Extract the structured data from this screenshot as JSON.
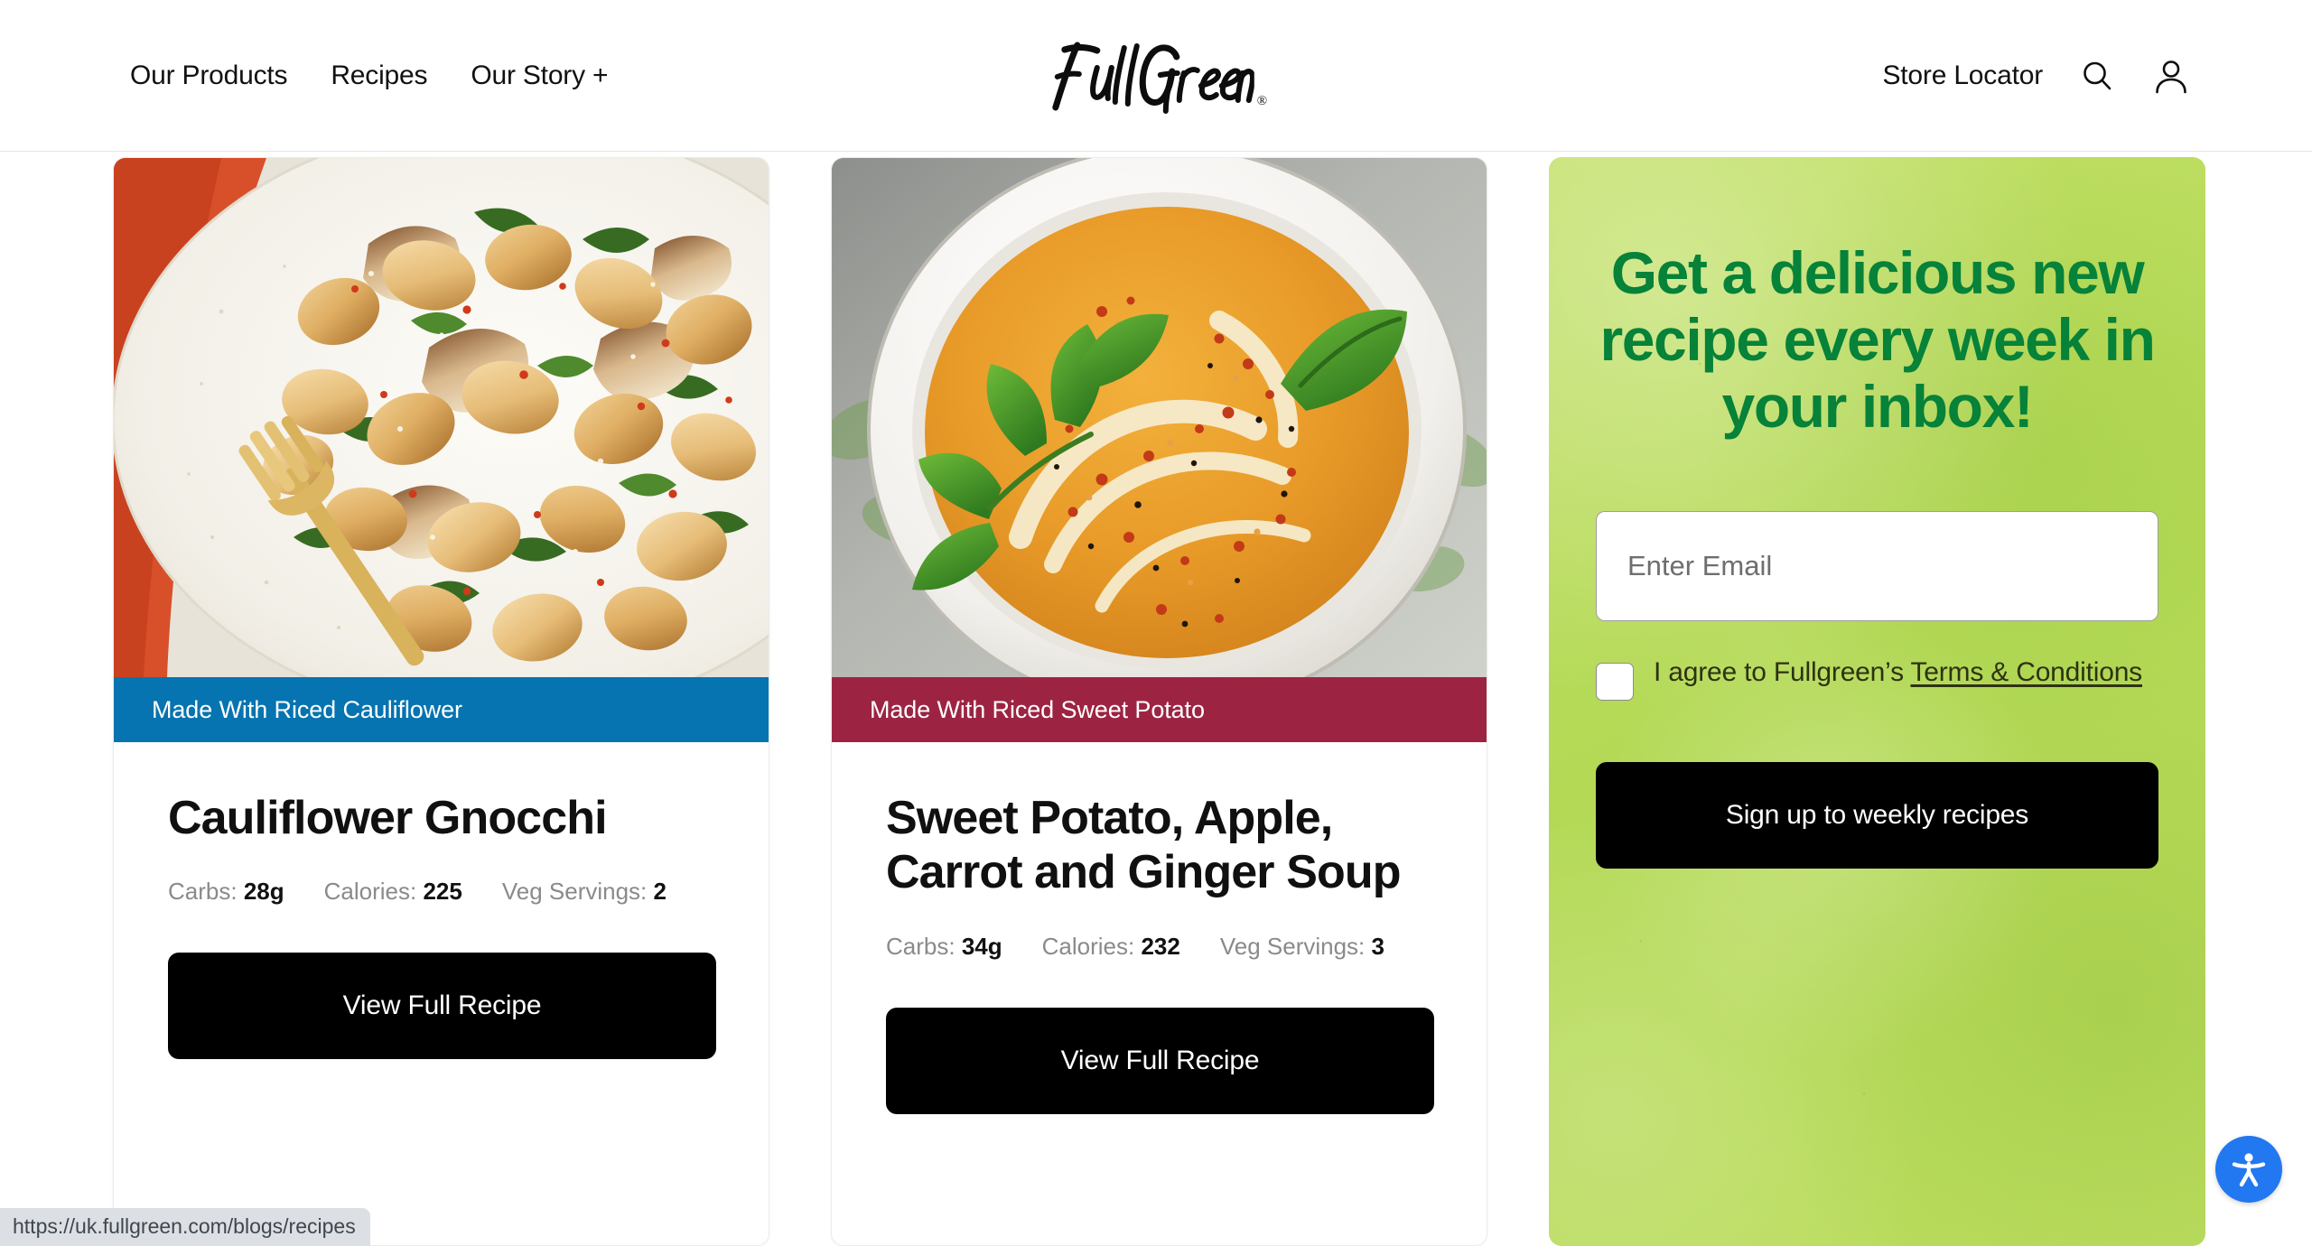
{
  "header": {
    "nav_links": [
      {
        "label": "Our Products",
        "name": "nav-our-products"
      },
      {
        "label": "Recipes",
        "name": "nav-recipes"
      },
      {
        "label": "Our Story +",
        "name": "nav-our-story"
      }
    ],
    "logo_text": "FullGreen",
    "logo_registered": "®",
    "store_locator": "Store Locator",
    "search_icon": "search-icon",
    "account_icon": "user-account-icon"
  },
  "cards": [
    {
      "ribbon": "Made With Riced Cauliflower",
      "ribbon_color": "#0574b0",
      "title": "Cauliflower Gnocchi",
      "nutrition": [
        {
          "label": "Carbs:",
          "value": "28g"
        },
        {
          "label": "Calories:",
          "value": "225"
        },
        {
          "label": "Veg Servings:",
          "value": "2"
        }
      ],
      "button": "View Full Recipe",
      "photo_alt": "cauliflower-gnocchi-photo"
    },
    {
      "ribbon": "Made With Riced Sweet Potato",
      "ribbon_color": "#9c2442",
      "title": "Sweet Potato, Apple, Carrot and Ginger Soup",
      "nutrition": [
        {
          "label": "Carbs:",
          "value": "34g"
        },
        {
          "label": "Calories:",
          "value": "232"
        },
        {
          "label": "Veg Servings:",
          "value": "3"
        }
      ],
      "button": "View Full Recipe",
      "photo_alt": "sweet-potato-soup-photo"
    }
  ],
  "newsletter": {
    "heading": "Get a delicious new recipe every week in your inbox!",
    "email_placeholder": "Enter Email",
    "email_value": "",
    "consent_prefix": "I agree to Fullgreen’s ",
    "consent_link": "Terms & Conditions",
    "signup_button": "Sign up to weekly recipes",
    "bg_color": "#b9dd5e",
    "heading_color": "#068239"
  },
  "overlays": {
    "status_url": "https://uk.fullgreen.com/blogs/recipes",
    "accessibility_icon": "accessibility-person-icon",
    "accessibility_color": "#2178f0"
  }
}
